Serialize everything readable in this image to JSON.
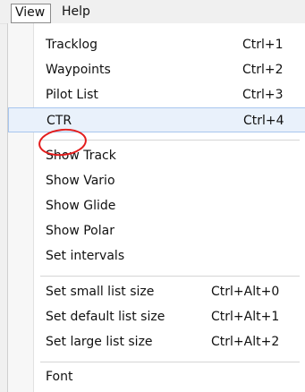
{
  "menubar": {
    "view_label": "View",
    "help_label": "Help"
  },
  "menu": {
    "items": [
      {
        "label": "Tracklog",
        "shortcut": "Ctrl+1"
      },
      {
        "label": "Waypoints",
        "shortcut": "Ctrl+2"
      },
      {
        "label": "Pilot List",
        "shortcut": "Ctrl+3"
      },
      {
        "label": "CTR",
        "shortcut": "Ctrl+4",
        "highlighted": true
      },
      {
        "label": "Show Track",
        "shortcut": ""
      },
      {
        "label": "Show Vario",
        "shortcut": ""
      },
      {
        "label": "Show Glide",
        "shortcut": ""
      },
      {
        "label": "Show Polar",
        "shortcut": ""
      },
      {
        "label": "Set intervals",
        "shortcut": ""
      },
      {
        "label": "Set small list size",
        "shortcut": "Ctrl+Alt+0"
      },
      {
        "label": "Set default list size",
        "shortcut": "Ctrl+Alt+1"
      },
      {
        "label": "Set large list size",
        "shortcut": "Ctrl+Alt+2"
      },
      {
        "label": "Font",
        "shortcut": ""
      }
    ]
  },
  "colors": {
    "highlight_bg": "#e9f1fb",
    "highlight_border": "#a8c6ee",
    "annotation": "#e31c1c"
  }
}
